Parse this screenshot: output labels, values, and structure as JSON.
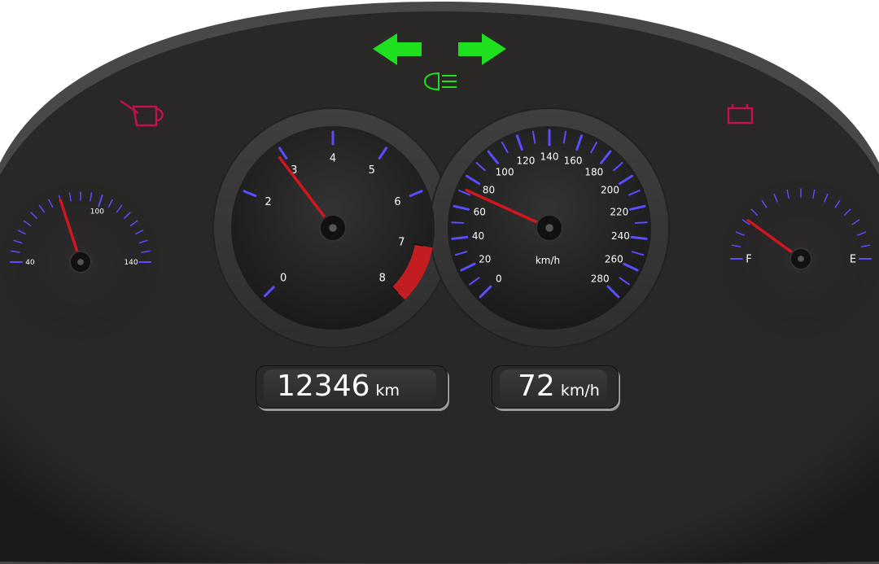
{
  "colors": {
    "dash": "#2a2727",
    "tick": "#5a4cff",
    "needle": "#d0161e",
    "warning": "#c2124a",
    "indicator": "#1ee01e",
    "redline": "#c21d20"
  },
  "icons": {
    "left_turn": "left-turn-arrow-icon",
    "right_turn": "right-turn-arrow-icon",
    "headlight": "low-beam-headlight-icon",
    "oil": "oil-can-icon",
    "battery": "battery-icon"
  },
  "temperature_gauge": {
    "labels": [
      "40",
      "100",
      "140"
    ],
    "value": 80
  },
  "tachometer": {
    "labels": [
      "0",
      "2",
      "3",
      "4",
      "5",
      "6",
      "7",
      "8"
    ],
    "value": 2.9,
    "redline_from": 7
  },
  "speedometer": {
    "labels": [
      "0",
      "20",
      "40",
      "60",
      "80",
      "100",
      "120",
      "140",
      "160",
      "180",
      "200",
      "220",
      "240",
      "260",
      "280"
    ],
    "unit": "km/h",
    "value": 72
  },
  "fuel_gauge": {
    "labels": [
      "F",
      "E"
    ],
    "value": 0.2
  },
  "odometer": {
    "value": "12346",
    "unit": "km"
  },
  "speed_readout": {
    "value": "72",
    "unit": "km/h"
  }
}
